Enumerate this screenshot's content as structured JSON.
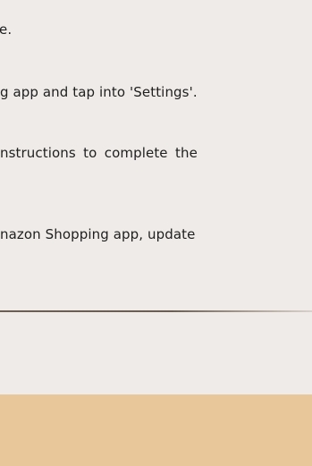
{
  "article": {
    "lines": [
      "e.",
      "g app and tap into 'Settings'.",
      "nstructions to complete the",
      "nazon Shopping app, update"
    ]
  },
  "colors": {
    "background": "#efebe8",
    "text": "#1f1f1f",
    "divider": "#6e5e52",
    "footer": "#e8c79a"
  }
}
